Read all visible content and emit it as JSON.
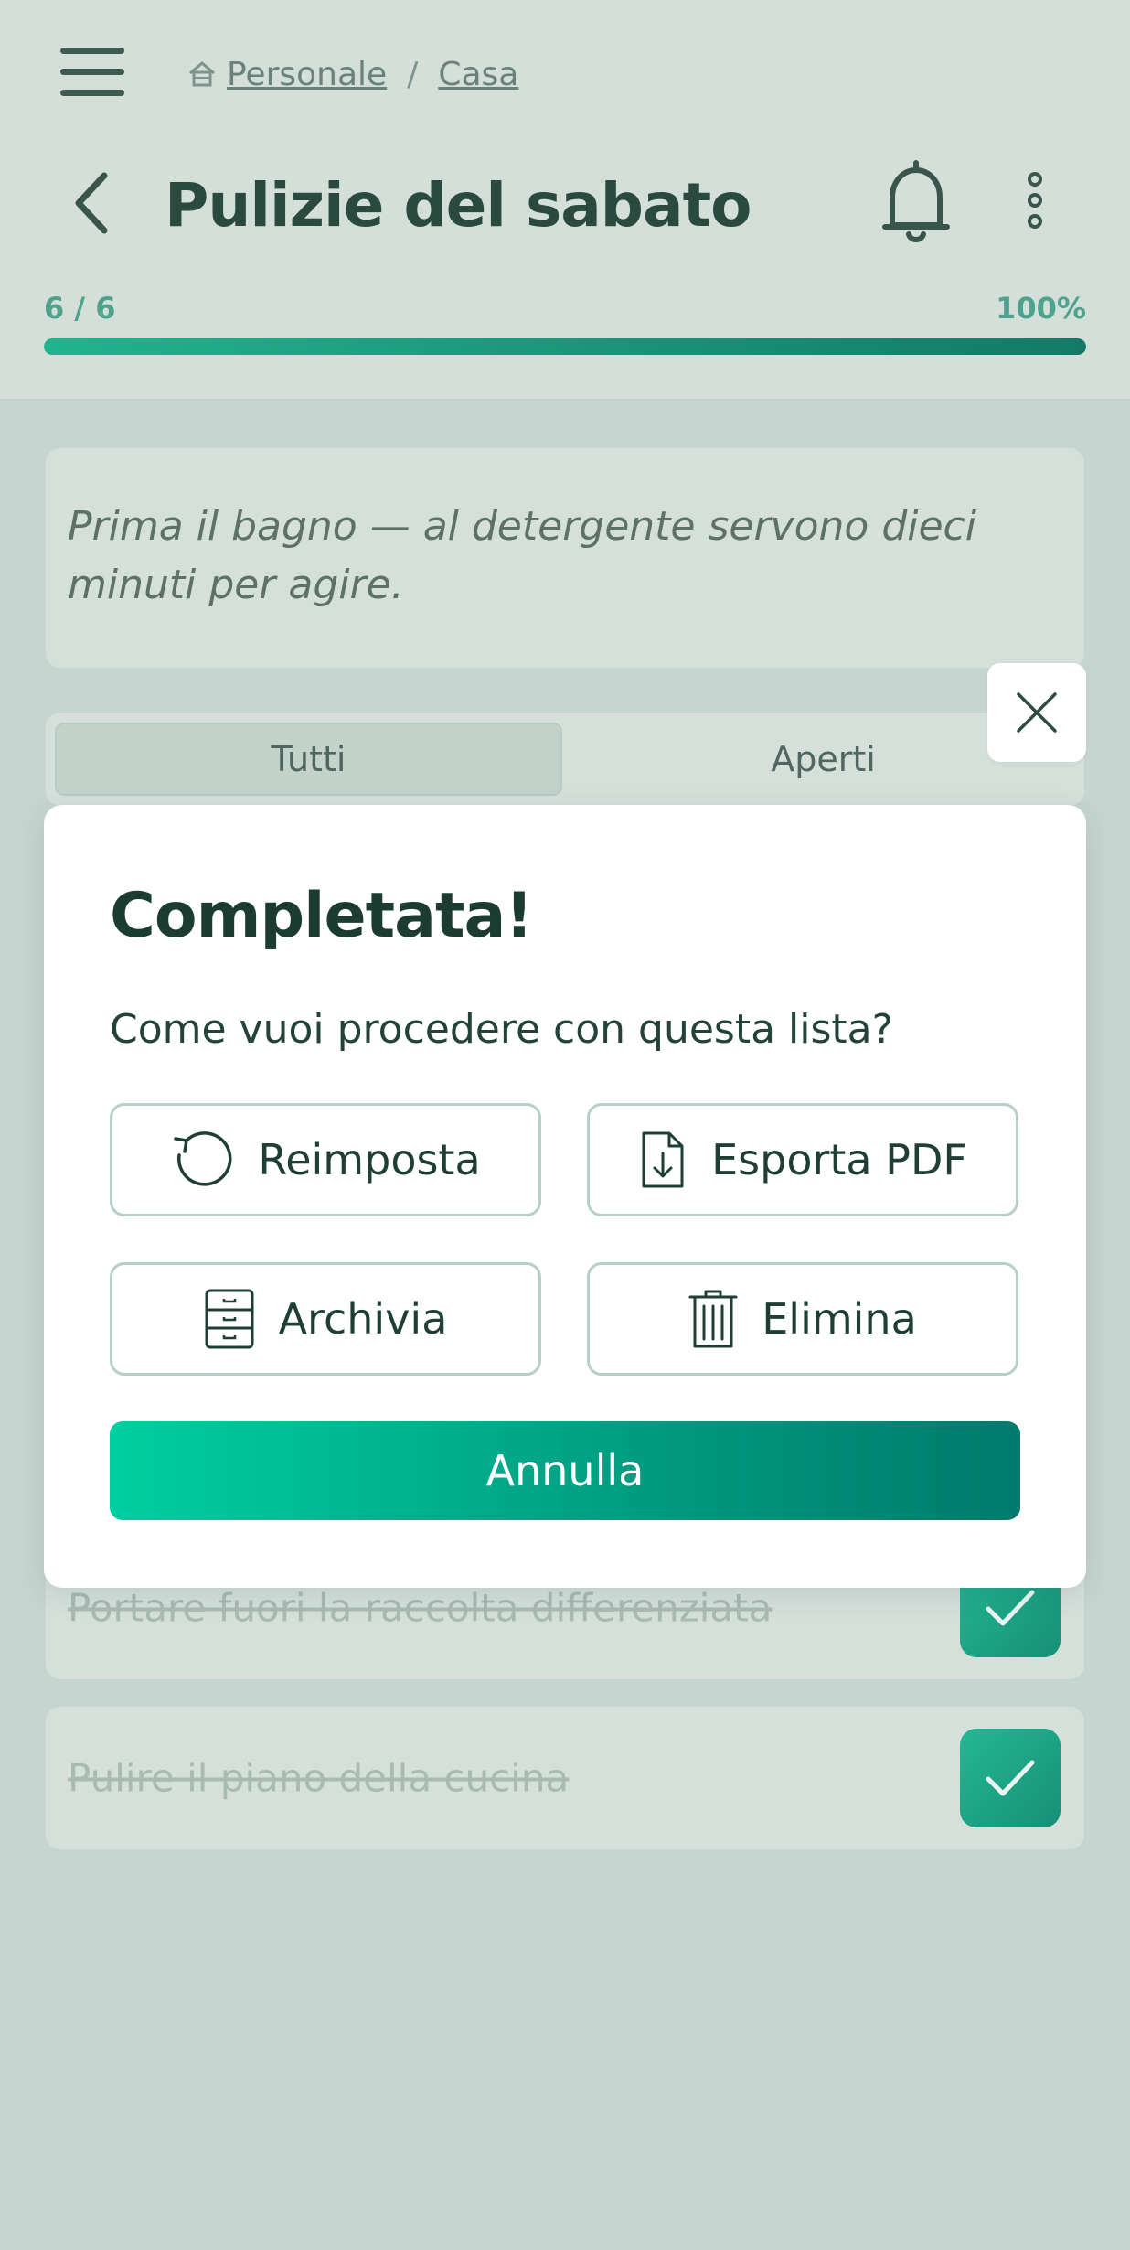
{
  "header": {
    "breadcrumb": [
      "Personale",
      "Casa"
    ],
    "breadcrumb_separator": "/",
    "title": "Pulizie del sabato",
    "progress": {
      "label": "6 / 6",
      "percent_label": "100%",
      "value": 1.0
    }
  },
  "note": {
    "text": "Prima il bagno — al detergente servono dieci minuti per agire."
  },
  "tabs": [
    {
      "label": "Tutti",
      "active": true
    },
    {
      "label": "Aperti",
      "active": false
    }
  ],
  "tasks": [
    {
      "label": "Portare fuori la raccolta differenziata",
      "done": true
    },
    {
      "label": "Pulire il piano della cucina",
      "done": true
    }
  ],
  "modal": {
    "title": "Completata!",
    "question": "Come vuoi procedere con questa lista?",
    "actions": {
      "reset": "Reimposta",
      "export_pdf": "Esporta PDF",
      "archive": "Archivia",
      "delete": "Elimina"
    },
    "cancel": "Annulla"
  },
  "colors": {
    "accent": "#00a886",
    "accent_dark": "#007a6c",
    "accent_light": "#00cfa0",
    "text_dark": "#1c3b31",
    "overlay_bg": "#c6d5cf"
  },
  "icons": [
    "menu-icon",
    "home-icon",
    "chevron-left-icon",
    "bell-icon",
    "more-vertical-icon",
    "close-icon",
    "reset-icon",
    "file-download-icon",
    "archive-cabinet-icon",
    "trash-icon",
    "check-icon"
  ]
}
